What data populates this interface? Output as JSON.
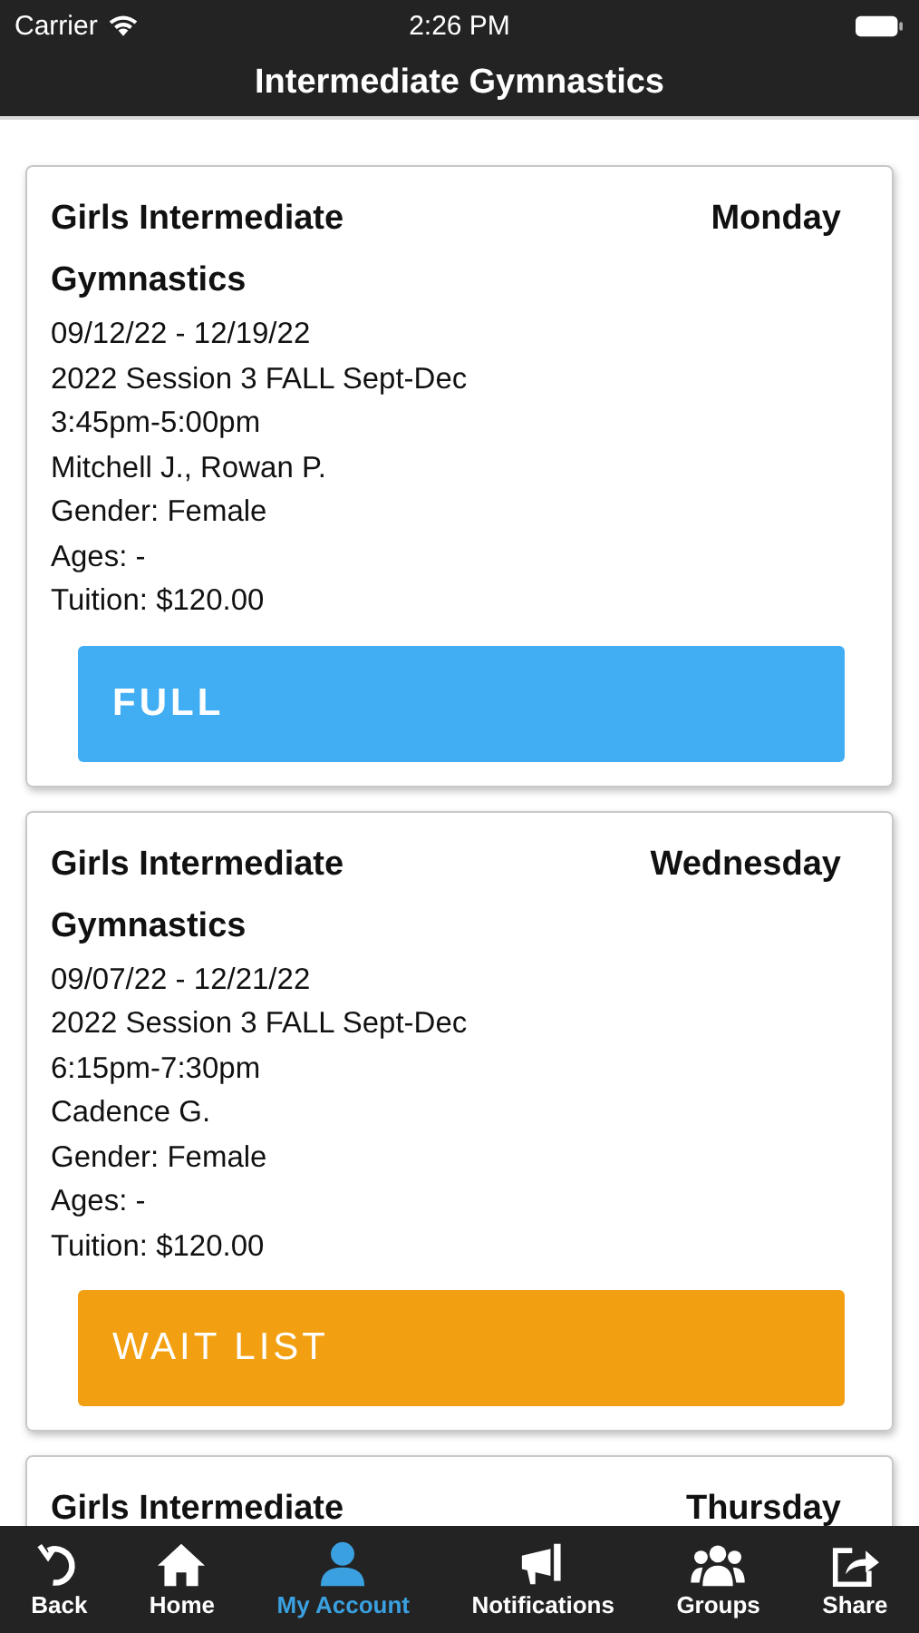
{
  "status_bar": {
    "carrier": "Carrier",
    "time": "2:26 PM"
  },
  "nav_title": "Intermediate Gymnastics",
  "classes": [
    {
      "title": "Girls Intermediate Gymnastics",
      "day": "Monday",
      "details": [
        "09/12/22 - 12/19/22",
        "2022 Session 3 FALL Sept-Dec",
        "3:45pm-5:00pm",
        "Mitchell J., Rowan P.",
        "Gender: Female",
        "Ages: -",
        "Tuition: $120.00"
      ],
      "button": {
        "label": "FULL",
        "kind": "full"
      }
    },
    {
      "title": "Girls Intermediate Gymnastics",
      "day": "Wednesday",
      "details": [
        "09/07/22 - 12/21/22",
        "2022 Session 3 FALL Sept-Dec",
        "6:15pm-7:30pm",
        "Cadence G.",
        "Gender: Female",
        "Ages: -",
        "Tuition: $120.00"
      ],
      "button": {
        "label": "WAIT LIST",
        "kind": "waitlist"
      }
    },
    {
      "title": "Girls Intermediate",
      "day": "Thursday"
    }
  ],
  "tab_bar": [
    {
      "label": "Back",
      "kind": "back",
      "selected": false
    },
    {
      "label": "Home",
      "kind": "home",
      "selected": false
    },
    {
      "label": "My Account",
      "kind": "person",
      "selected": true
    },
    {
      "label": "Notifications",
      "kind": "megaphone",
      "selected": false
    },
    {
      "label": "Groups",
      "kind": "group",
      "selected": false
    },
    {
      "label": "Share",
      "kind": "share",
      "selected": false
    }
  ]
}
